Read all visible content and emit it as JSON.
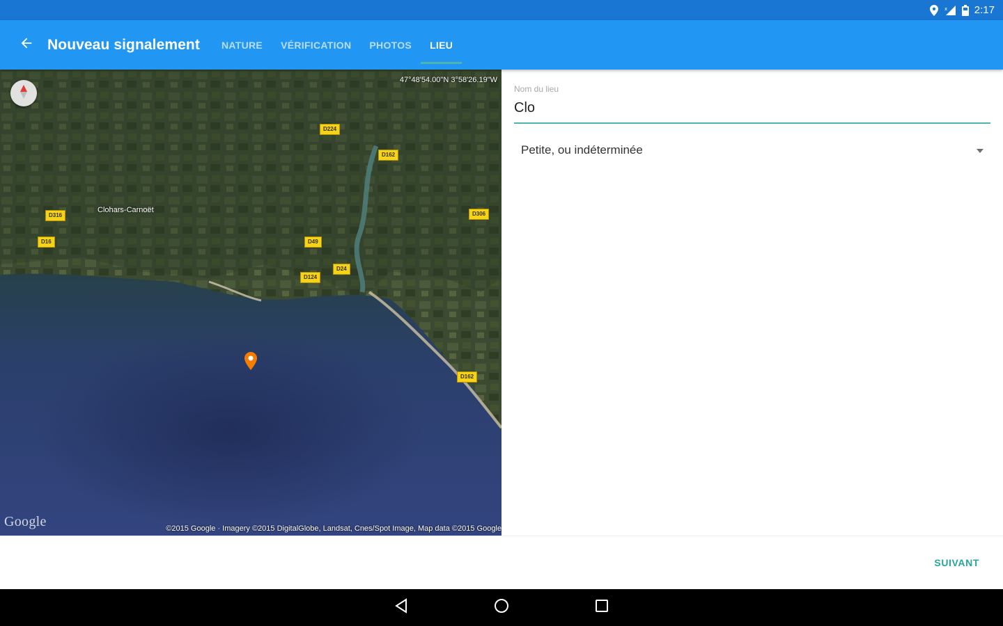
{
  "status_bar": {
    "time": "2:17",
    "icons": [
      "location-icon",
      "signal-icon",
      "battery-icon"
    ]
  },
  "app_bar": {
    "title": "Nouveau signalement",
    "back_icon": "arrow-back-icon",
    "tabs": [
      {
        "label": "NATURE",
        "active": false
      },
      {
        "label": "VÉRIFICATION",
        "active": false
      },
      {
        "label": "PHOTOS",
        "active": false
      },
      {
        "label": "LIEU",
        "active": true
      }
    ],
    "accent_color": "#2196f3",
    "indicator_color": "#4db6ac"
  },
  "map": {
    "coordinates": "47°48'54.00\"N 3°58'26.19\"W",
    "place_label": "Clohars-Carnoët",
    "road_labels": [
      "D224",
      "D162",
      "D316",
      "D16",
      "D306",
      "D49",
      "D24",
      "D124",
      "D162"
    ],
    "google_logo": "Google",
    "attribution": "©2015 Google · Imagery ©2015 DigitalGlobe, Landsat, Cnes/Spot Image, Map data ©2015 Google",
    "compass_icon": "compass-icon",
    "marker_icon": "map-pin-icon",
    "marker_color": "#f57c00",
    "locate_icon": "my-location-icon"
  },
  "form": {
    "place_name": {
      "label": "Nom du lieu",
      "value": "Clo"
    },
    "size_select": {
      "value": "Petite, ou indéterminée",
      "icon": "dropdown-arrow-icon"
    }
  },
  "actions": {
    "next_label": "SUIVANT",
    "next_color": "#26a69a"
  },
  "nav_bar": {
    "icons": [
      "back-triangle-icon",
      "home-circle-icon",
      "recents-square-icon"
    ]
  }
}
